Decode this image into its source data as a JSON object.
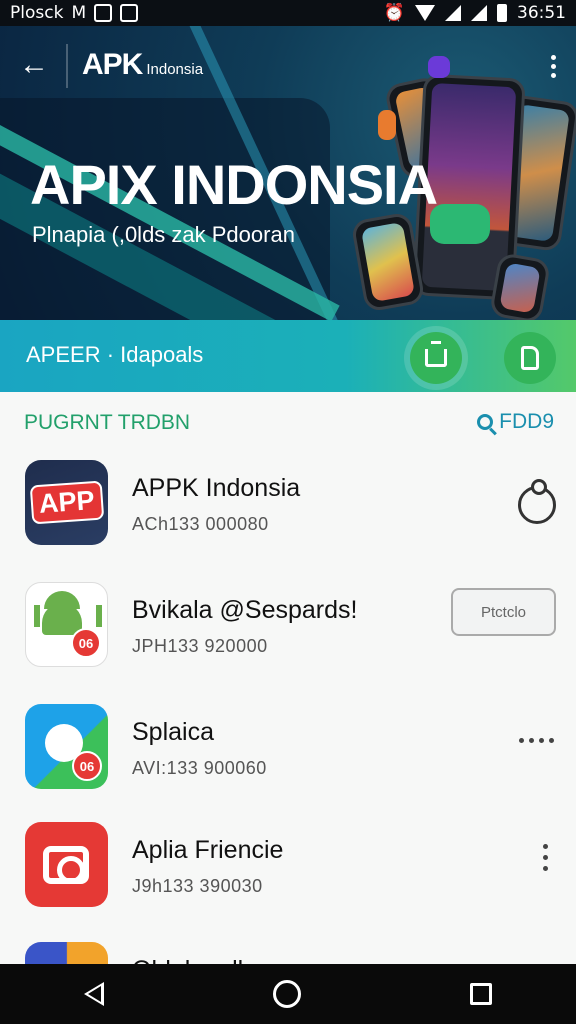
{
  "status_bar": {
    "carrier": "Plosck",
    "label": "M",
    "time": "36:51"
  },
  "header": {
    "logo_main": "APK",
    "logo_sub": "Indonsia"
  },
  "hero": {
    "title": "APIX INDONSIA",
    "subtitle": "Plnapia (,0lds zak Pdooran"
  },
  "banner": {
    "text": "APEER · Idapoals"
  },
  "section": {
    "title": "PUGRNT TRDBN",
    "search_label": "FDD9"
  },
  "apps": [
    {
      "name": "APPK Indonsia",
      "meta": "ACh133 000080",
      "icon_text": "APP",
      "action": "share"
    },
    {
      "name": "Bvikala @Sespards!",
      "meta": "JPH133 920000",
      "badge": "06",
      "action_label": "Ptctclo"
    },
    {
      "name": "Splaica",
      "meta": "AVI:133 900060",
      "badge": "06",
      "action": "more-horizontal"
    },
    {
      "name": "Aplia Friencie",
      "meta": "J9h133 390030",
      "action": "more-vertical"
    },
    {
      "name": "Oldaleaalk",
      "meta": ""
    }
  ],
  "colors": {
    "accent_green": "#22a06b",
    "accent_teal": "#1a8fae",
    "banner_start": "#1aa5c2",
    "banner_end": "#54c96a"
  }
}
